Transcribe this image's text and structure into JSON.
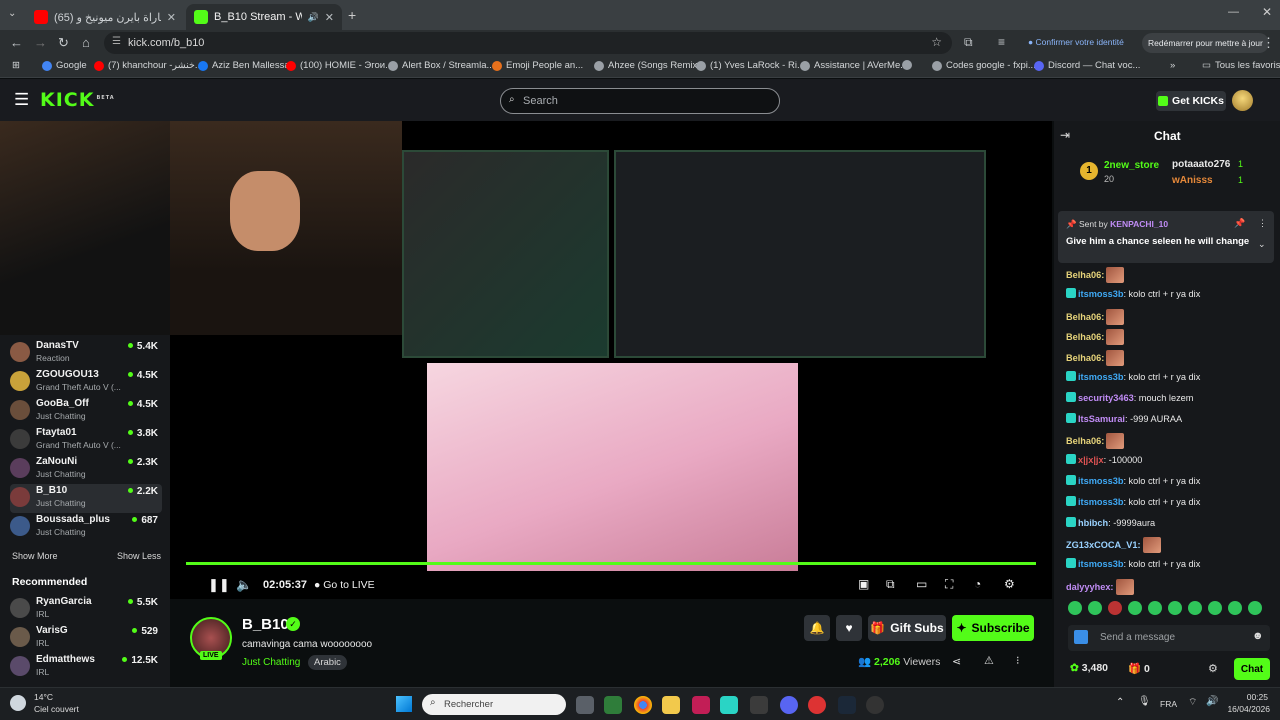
{
  "browser": {
    "tabs": [
      {
        "label": "(65) ملخص مباراة بايرن ميونيخ و..."
      },
      {
        "label": "B_B10 Stream - Watch Live"
      }
    ],
    "url": "kick.com/b_b10",
    "identity_label": "Confirmer votre identité",
    "restart_label": "Redémarrer pour mettre à jour",
    "bookmarks": [
      {
        "label": "Google",
        "color": "#4285f4"
      },
      {
        "label": "(7) khanchour -خنشر...",
        "color": "#ff0000"
      },
      {
        "label": "Aziz Ben Mallessa",
        "color": "#1877f2"
      },
      {
        "label": "(100) HOMIE - Эгои...",
        "color": "#ff0000"
      },
      {
        "label": "Alert Box / Streamla...",
        "color": "#9aa0a6"
      },
      {
        "label": "Emoji People an...",
        "color": "#e8711c"
      },
      {
        "label": "Ahzee (Songs Remix...",
        "color": "#9aa0a6"
      },
      {
        "label": "(1) Yves LaRock - Ri...",
        "color": "#9aa0a6"
      },
      {
        "label": "Assistance | AVerMe...",
        "color": "#9aa0a6"
      },
      {
        "label": "Codes google - fxpi...",
        "color": "#9aa0a6"
      },
      {
        "label": "Discord — Chat voc...",
        "color": "#5865f2"
      }
    ],
    "all_bookmarks_label": "Tous les favoris"
  },
  "header": {
    "logo": "KICK",
    "logo_sup": "BETA",
    "search_placeholder": "Search",
    "get_kicks": "Get KICKs"
  },
  "sidebar": {
    "following": [
      {
        "name": "DanasTV",
        "category": "Reaction",
        "viewers": "5.4K",
        "color": "#8a5a44"
      },
      {
        "name": "ZGOUGOU13",
        "category": "Grand Theft Auto V (...",
        "viewers": "4.5K",
        "color": "#c9a23a"
      },
      {
        "name": "GooBa_Off",
        "category": "Just Chatting",
        "viewers": "4.5K",
        "color": "#6a4e3b"
      },
      {
        "name": "Ftayta01",
        "category": "Grand Theft Auto V (...",
        "viewers": "3.8K",
        "color": "#3b3b3b"
      },
      {
        "name": "ZaNouNi",
        "category": "Just Chatting",
        "viewers": "2.3K",
        "color": "#5a3d5c"
      },
      {
        "name": "B_B10",
        "category": "Just Chatting",
        "viewers": "2.2K",
        "color": "#7a3b3b"
      },
      {
        "name": "Boussada_plus",
        "category": "Just Chatting",
        "viewers": "687",
        "color": "#3c5a8a"
      }
    ],
    "show_more": "Show More",
    "show_less": "Show Less",
    "recommended_title": "Recommended",
    "recommended": [
      {
        "name": "RyanGarcia",
        "category": "IRL",
        "viewers": "5.5K",
        "color": "#4a4a4a"
      },
      {
        "name": "VarisG",
        "category": "IRL",
        "viewers": "529",
        "color": "#6a5a4a"
      },
      {
        "name": "Edmatthews",
        "category": "IRL",
        "viewers": "12.5K",
        "color": "#5a4a6a"
      }
    ]
  },
  "player": {
    "time": "02:05:37",
    "go_live": "Go to LIVE"
  },
  "stream": {
    "name": "B_B10",
    "live": "LIVE",
    "title": "camavinga cama woooooooo",
    "category": "Just Chatting",
    "tag": "Arabic",
    "viewers": "2,206",
    "viewers_label": "Viewers",
    "gift_subs": "Gift Subs",
    "subscribe": "Subscribe"
  },
  "chat": {
    "title": "Chat",
    "leaderboard": [
      {
        "rank": "1",
        "name": "2new_store",
        "count": "20"
      },
      {
        "name": "potaaato276",
        "count": "1"
      },
      {
        "name": "wAnisss",
        "count": "1"
      }
    ],
    "pinned": {
      "sent_by": "Sent by",
      "user": "KENPACHI_10",
      "text": "Give him a chance seleen he will change"
    },
    "messages": [
      {
        "user": "Belha06:",
        "text": "",
        "emote": true,
        "color": "#e6d37a"
      },
      {
        "user": "itsmoss3b",
        "text": ": kolo ctrl + r ya dix",
        "emote": false,
        "color": "#3fa9f5"
      },
      {
        "user": "Belha06:",
        "text": "",
        "emote": true,
        "color": "#e6d37a"
      },
      {
        "user": "Belha06:",
        "text": "",
        "emote": true,
        "color": "#e6d37a"
      },
      {
        "user": "Belha06:",
        "text": "",
        "emote": true,
        "color": "#e6d37a"
      },
      {
        "user": "itsmoss3b",
        "text": ": kolo ctrl + r ya dix",
        "emote": false,
        "color": "#3fa9f5"
      },
      {
        "user": "security3463",
        "text": ": mouch lezem",
        "emote": false,
        "color": "#c08cf5"
      },
      {
        "user": "ItsSamurai",
        "text": ": -999 AURAA",
        "emote": false,
        "color": "#c08cf5"
      },
      {
        "user": "Belha06:",
        "text": "",
        "emote": true,
        "color": "#e6d37a"
      },
      {
        "user": "x|jx|jx",
        "text": ": -100000",
        "emote": false,
        "color": "#e05353"
      },
      {
        "user": "itsmoss3b",
        "text": ": kolo ctrl + r ya dix",
        "emote": false,
        "color": "#3fa9f5"
      },
      {
        "user": "itsmoss3b",
        "text": ": kolo ctrl + r ya dix",
        "emote": false,
        "color": "#3fa9f5"
      },
      {
        "user": "hbibch",
        "text": ": -9999aura",
        "emote": false,
        "color": "#9ad2ff"
      },
      {
        "user": "ZG13xCOCA_V1:",
        "text": "",
        "emote": true,
        "color": "#9ad2ff"
      },
      {
        "user": "itsmoss3b",
        "text": ": kolo ctrl + r ya dix",
        "emote": false,
        "color": "#3fa9f5"
      },
      {
        "user": "dalyyyhex:",
        "text": "",
        "emote": true,
        "color": "#c08cf5"
      }
    ],
    "input_placeholder": "Send a message",
    "points": "3,480",
    "gifts": "0",
    "send_label": "Chat"
  },
  "taskbar": {
    "weather_temp": "14°C",
    "weather_text": "Ciel couvert",
    "search_placeholder": "Rechercher",
    "lang": "FRA",
    "time": "00:25",
    "date": "16/04/2026"
  },
  "colors": {
    "kick_green": "#53fc18",
    "bg": "#0b0e0f",
    "panel": "#16181b"
  }
}
